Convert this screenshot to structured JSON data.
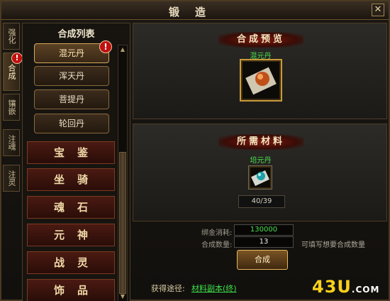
{
  "window": {
    "title": "锻造",
    "close_label": "✕"
  },
  "tabs": [
    {
      "label": "强化"
    },
    {
      "label": "合成"
    },
    {
      "label": "镶嵌"
    },
    {
      "label": "注魂"
    },
    {
      "label": "注灵"
    }
  ],
  "tab_badge": "!",
  "list": {
    "header": "合成列表",
    "badge": "!",
    "sub_items": [
      {
        "label": "混元丹"
      },
      {
        "label": "浑天丹"
      },
      {
        "label": "菩提丹"
      },
      {
        "label": "轮回丹"
      }
    ],
    "categories": [
      {
        "label": "宝鉴"
      },
      {
        "label": "坐骑"
      },
      {
        "label": "魂石"
      },
      {
        "label": "元神"
      },
      {
        "label": "战灵"
      },
      {
        "label": "饰品"
      }
    ]
  },
  "preview": {
    "title": "合成预览",
    "item_name": "混元丹"
  },
  "materials": {
    "title": "所需材料",
    "item_name": "培元丹",
    "count": "40/39"
  },
  "form": {
    "cost_label": "绑金消耗:",
    "cost_value": "130000",
    "qty_label": "合成数量:",
    "qty_value": "13",
    "qty_hint": "可填写想要合成数量",
    "synth_label": "合成"
  },
  "obtain": {
    "label": "获得途径:",
    "link": "材料副本(终)"
  },
  "watermark": {
    "main": "43U",
    "suffix": ".COM"
  },
  "colors": {
    "accent_gold": "#c79a3a",
    "link_green": "#3de04a",
    "badge_red": "#c01010"
  }
}
